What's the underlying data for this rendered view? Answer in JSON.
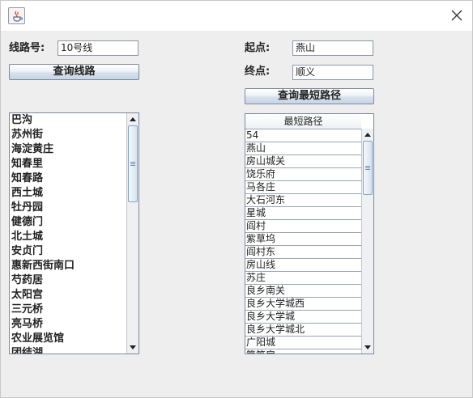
{
  "window": {
    "close_symbol": "×"
  },
  "left": {
    "line_label": "线路号:",
    "line_value": "10号线",
    "query_line_button": "查询线路",
    "stations": [
      "巴沟",
      "苏州街",
      "海淀黄庄",
      "知春里",
      "知春路",
      "西土城",
      "牡丹园",
      "健德门",
      "北土城",
      "安贞门",
      "惠新西街南口",
      "芍药居",
      "太阳宫",
      "三元桥",
      "亮马桥",
      "农业展览馆",
      "团结湖"
    ]
  },
  "right": {
    "start_label": "起点:",
    "start_value": "燕山",
    "end_label": "终点:",
    "end_value": "顺义",
    "query_path_button": "查询最短路径",
    "table_header": "最短路径",
    "rows": [
      "54",
      "燕山",
      "房山城关",
      "饶乐府",
      "马各庄",
      "大石河东",
      "星城",
      "阎村",
      "紫草坞",
      "阎村东",
      "房山线",
      "苏庄",
      "良乡南关",
      "良乡大学城西",
      "良乡大学城",
      "良乡大学城北",
      "广阳城",
      "篱笆房"
    ]
  },
  "icons": {
    "app": "java-icon",
    "close": "close-icon",
    "scroll_up": "arrow-up-icon",
    "scroll_down": "arrow-down-icon"
  }
}
